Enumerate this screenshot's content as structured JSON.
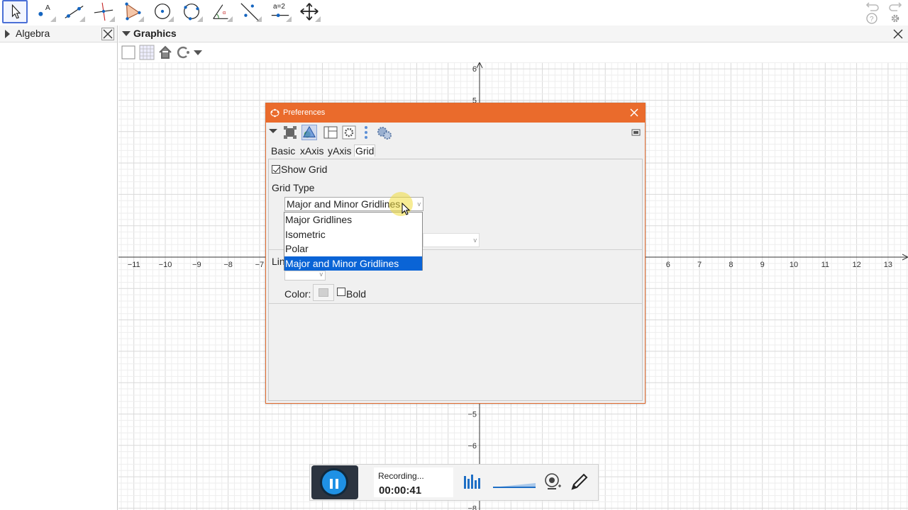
{
  "toolbar": {
    "tools": [
      "move-tool",
      "point-tool",
      "line-tool",
      "perpendicular-line-tool",
      "polygon-tool",
      "circle-center-tool",
      "circle-three-points-tool",
      "angle-tool",
      "reflect-tool",
      "slider-tool",
      "move-graphics-tool"
    ],
    "slider_tool_label": "a=2"
  },
  "algebra": {
    "title": "Algebra"
  },
  "graphics": {
    "title": "Graphics",
    "x_ticks": [
      "-11",
      "-10",
      "-9",
      "-8",
      "-7",
      "6",
      "7",
      "8",
      "9",
      "10",
      "11",
      "12",
      "13"
    ],
    "y_ticks": [
      "6",
      "5",
      "-5",
      "-6",
      "-8"
    ]
  },
  "prefs": {
    "title": "Preferences",
    "tabs": [
      "Basic",
      "xAxis",
      "yAxis",
      "Grid"
    ],
    "show_grid_label": "Show Grid",
    "grid_type_label": "Grid Type",
    "grid_type_value": "Major and Minor Gridlines",
    "options": [
      "Major Gridlines",
      "Isometric",
      "Polar",
      "Major and Minor Gridlines"
    ],
    "line_style_label_partial": "Lin",
    "color_label": "Color:",
    "bold_label": "Bold"
  },
  "recorder": {
    "status": "Recording...",
    "time": "00:00:41"
  },
  "colors": {
    "accent": "#ea6b2c",
    "selection": "#0a64d6",
    "record_button": "#1f91e5"
  }
}
